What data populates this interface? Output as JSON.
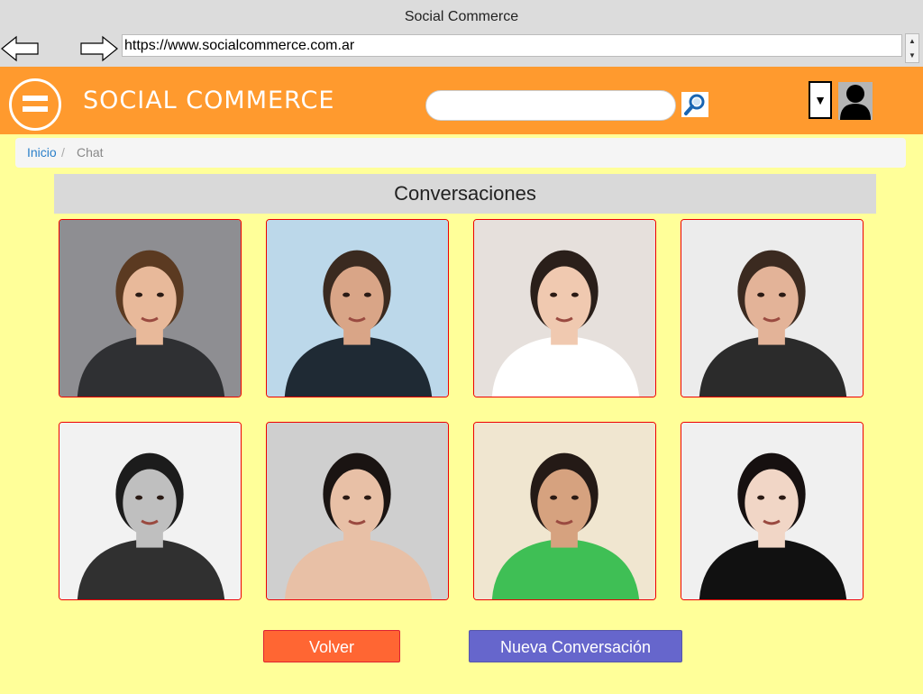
{
  "window": {
    "title": "Social Commerce",
    "url": "https://www.socialcommerce.com.ar"
  },
  "header": {
    "brand": "SOCIAL COMMERCE",
    "search_placeholder": "",
    "dropdown_symbol": "▼"
  },
  "breadcrumb": {
    "home": "Inicio",
    "separator": "/",
    "current": "Chat"
  },
  "section": {
    "title": "Conversaciones"
  },
  "contacts": [
    {
      "label": "",
      "bg": "#8e8e92",
      "skin": "#e8b99a",
      "hair": "#5b3a21",
      "shirt": "#2f3033"
    },
    {
      "label": "",
      "bg": "#bcd8ea",
      "skin": "#d9a587",
      "hair": "#3a2a20",
      "shirt": "#1f2a34"
    },
    {
      "label": "",
      "bg": "#e6e0dc",
      "skin": "#f0c9b0",
      "hair": "#2a1f1a",
      "shirt": "#ffffff"
    },
    {
      "label": "",
      "bg": "#ececec",
      "skin": "#e3b398",
      "hair": "#3b2a20",
      "shirt": "#2b2b2b"
    },
    {
      "label": "",
      "bg": "#f2f2f2",
      "skin": "#bfbfbf",
      "hair": "#1c1c1c",
      "shirt": "#303030"
    },
    {
      "label": "",
      "bg": "#cfcfcf",
      "skin": "#e8c0a6",
      "hair": "#1a1412",
      "shirt": "#e8c0a6"
    },
    {
      "label": "",
      "bg": "#f0e6d0",
      "skin": "#d6a27f",
      "hair": "#241a16",
      "shirt": "#3fbf55"
    },
    {
      "label": "",
      "bg": "#f0f0f0",
      "skin": "#f1d6c6",
      "hair": "#161010",
      "shirt": "#111111"
    }
  ],
  "actions": {
    "back": "Volver",
    "new_conversation": "Nueva Conversación"
  },
  "colors": {
    "header": "#ff9a2e",
    "page_bg": "#ffff99",
    "back_button": "#ff6633",
    "new_button": "#6666cc",
    "link": "#2a7fc9"
  },
  "icons": [
    "back-arrow-icon",
    "forward-arrow-icon",
    "menu-icon",
    "search-icon",
    "dropdown-icon",
    "user-avatar-icon"
  ]
}
